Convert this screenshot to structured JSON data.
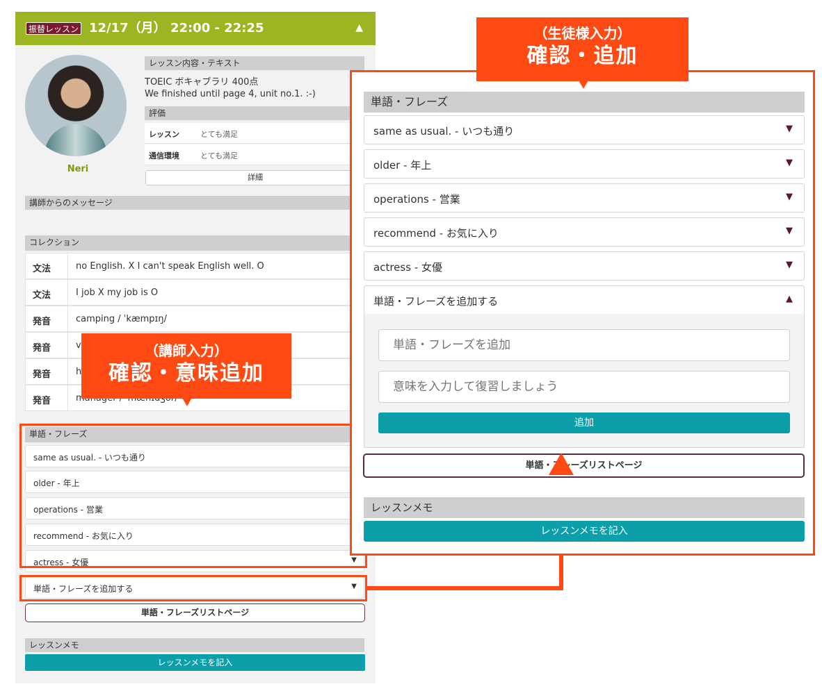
{
  "lesson_card": {
    "badge": "振替レッスン",
    "datetime": "12/17（月） 22:00 - 22:25",
    "toggle_icon": "▲",
    "teacher_name": "Neri",
    "content_header": "レッスン内容・テキスト",
    "content_line1": "TOEIC ボキャブラリ 400点",
    "content_line2": "We finished until page 4, unit no.1. :-)",
    "evaluation_header": "評価",
    "evaluation": [
      {
        "key": "レッスン",
        "value": "とても満足"
      },
      {
        "key": "通信環境",
        "value": "とても満足"
      }
    ],
    "detail_button": "詳細",
    "message_header": "講師からのメッセージ",
    "collection_header": "コレクション",
    "collection": [
      {
        "category": "文法",
        "text": "no English. X I can't speak English well. O"
      },
      {
        "category": "文法",
        "text": "I job X my job is O"
      },
      {
        "category": "発音",
        "text": "camping / ˈkæmpɪŋ/"
      },
      {
        "category": "発音",
        "text": "v"
      },
      {
        "category": "発音",
        "text": "h"
      },
      {
        "category": "発音",
        "text": "manager / ˈmænɪdʒər/"
      }
    ],
    "vocab_header": "単語・フレーズ",
    "vocab_items": [
      "same as usual. - いつも通り",
      "older - 年上",
      "operations - 営業",
      "recommend - お気に入り",
      "actress - 女優"
    ],
    "add_vocab_label": "単語・フレーズを追加する",
    "vocab_list_button": "単語・フレーズリストページ",
    "memo_header": "レッスンメモ",
    "memo_button": "レッスンメモを記入"
  },
  "zoom_panel": {
    "vocab_header": "単語・フレーズ",
    "vocab_items": [
      "same as usual. - いつも通り",
      "older - 年上",
      "operations - 営業",
      "recommend - お気に入り",
      "actress - 女優"
    ],
    "add_vocab_label": "単語・フレーズを追加する",
    "word_placeholder": "単語・フレーズを追加",
    "meaning_placeholder": "意味を入力して復習しましょう",
    "add_button": "追加",
    "vocab_list_button": "単語・フレーズリストページ",
    "memo_header": "レッスンメモ",
    "memo_button": "レッスンメモを記入"
  },
  "callouts": {
    "student_sub": "（生徒様入力）",
    "student_main": "確認・追加",
    "teacher_sub": "（講師入力）",
    "teacher_main": "確認・意味追加"
  },
  "icons": {
    "caret_down": "▼",
    "caret_up": "▲"
  },
  "colors": {
    "header_green": "#9cb623",
    "accent_teal": "#0d9fa9",
    "highlight_orange": "#ff4a14",
    "badge_maroon": "#7a1a2c"
  }
}
